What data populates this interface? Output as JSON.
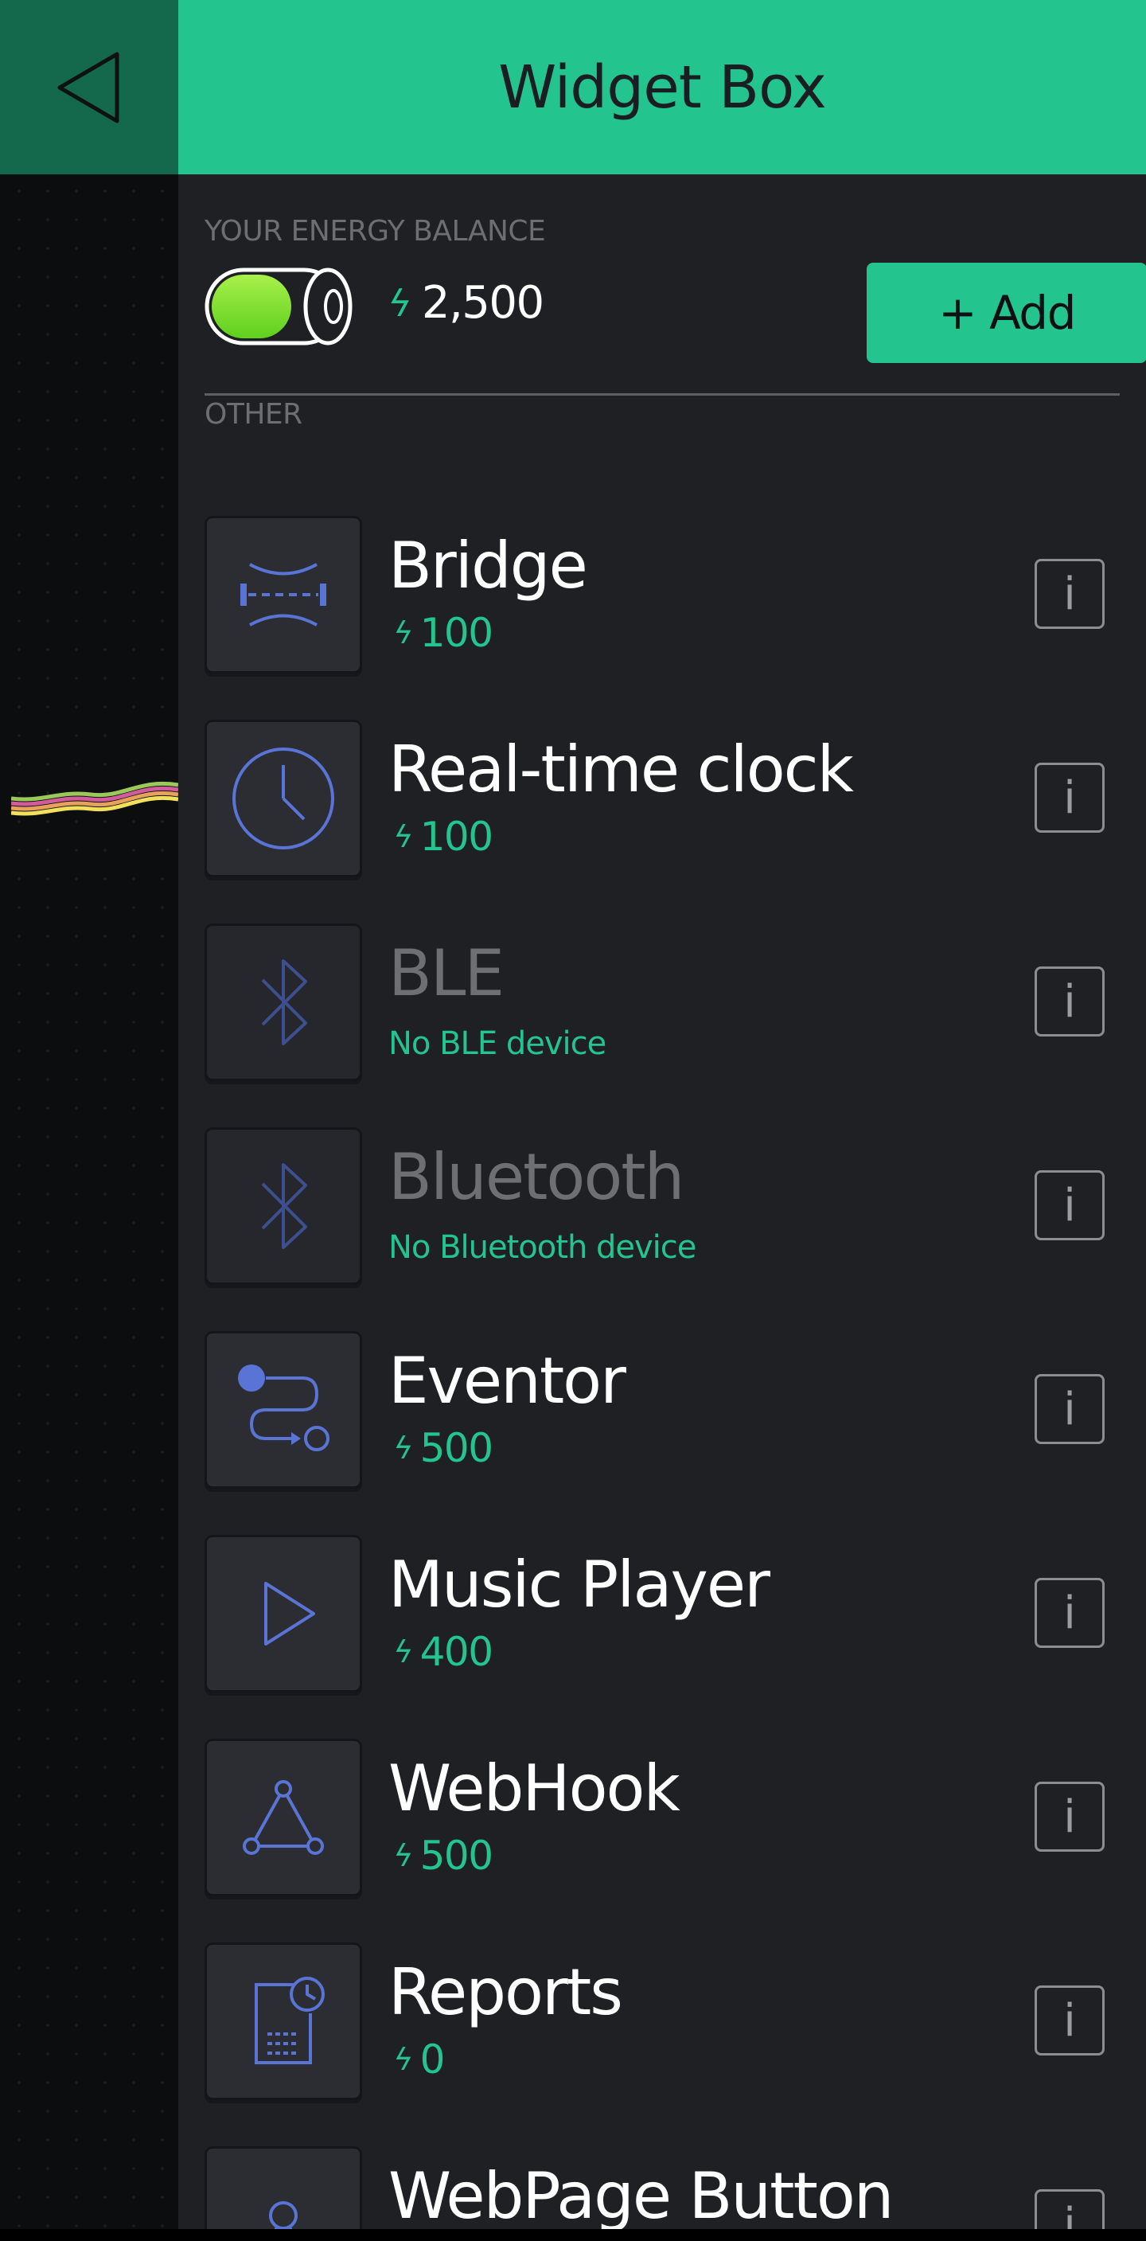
{
  "header": {
    "title": "Widget Box"
  },
  "energy": {
    "label": "YOUR ENERGY BALANCE",
    "amount": "2,500",
    "add_label": "+ Add"
  },
  "section": {
    "label": "OTHER"
  },
  "colors": {
    "accent": "#23c48e",
    "icon": "#5a74d6",
    "panel": "#1f2024"
  },
  "widgets": [
    {
      "name": "Bridge",
      "cost": "100",
      "icon": "bridge-icon",
      "disabled": false
    },
    {
      "name": "Real-time clock",
      "cost": "100",
      "icon": "clock-icon",
      "disabled": false
    },
    {
      "name": "BLE",
      "sub": "No BLE device",
      "icon": "bluetooth-icon",
      "disabled": true
    },
    {
      "name": "Bluetooth",
      "sub": "No Bluetooth device",
      "icon": "bluetooth-icon",
      "disabled": true
    },
    {
      "name": "Eventor",
      "cost": "500",
      "icon": "eventor-icon",
      "disabled": false
    },
    {
      "name": "Music Player",
      "cost": "400",
      "icon": "play-icon",
      "disabled": false
    },
    {
      "name": "WebHook",
      "cost": "500",
      "icon": "webhook-icon",
      "disabled": false
    },
    {
      "name": "Reports",
      "cost": "0",
      "icon": "report-icon",
      "disabled": false
    },
    {
      "name": "WebPage Button",
      "icon": "webpage-button-icon",
      "disabled": false
    }
  ],
  "info_label": "i"
}
